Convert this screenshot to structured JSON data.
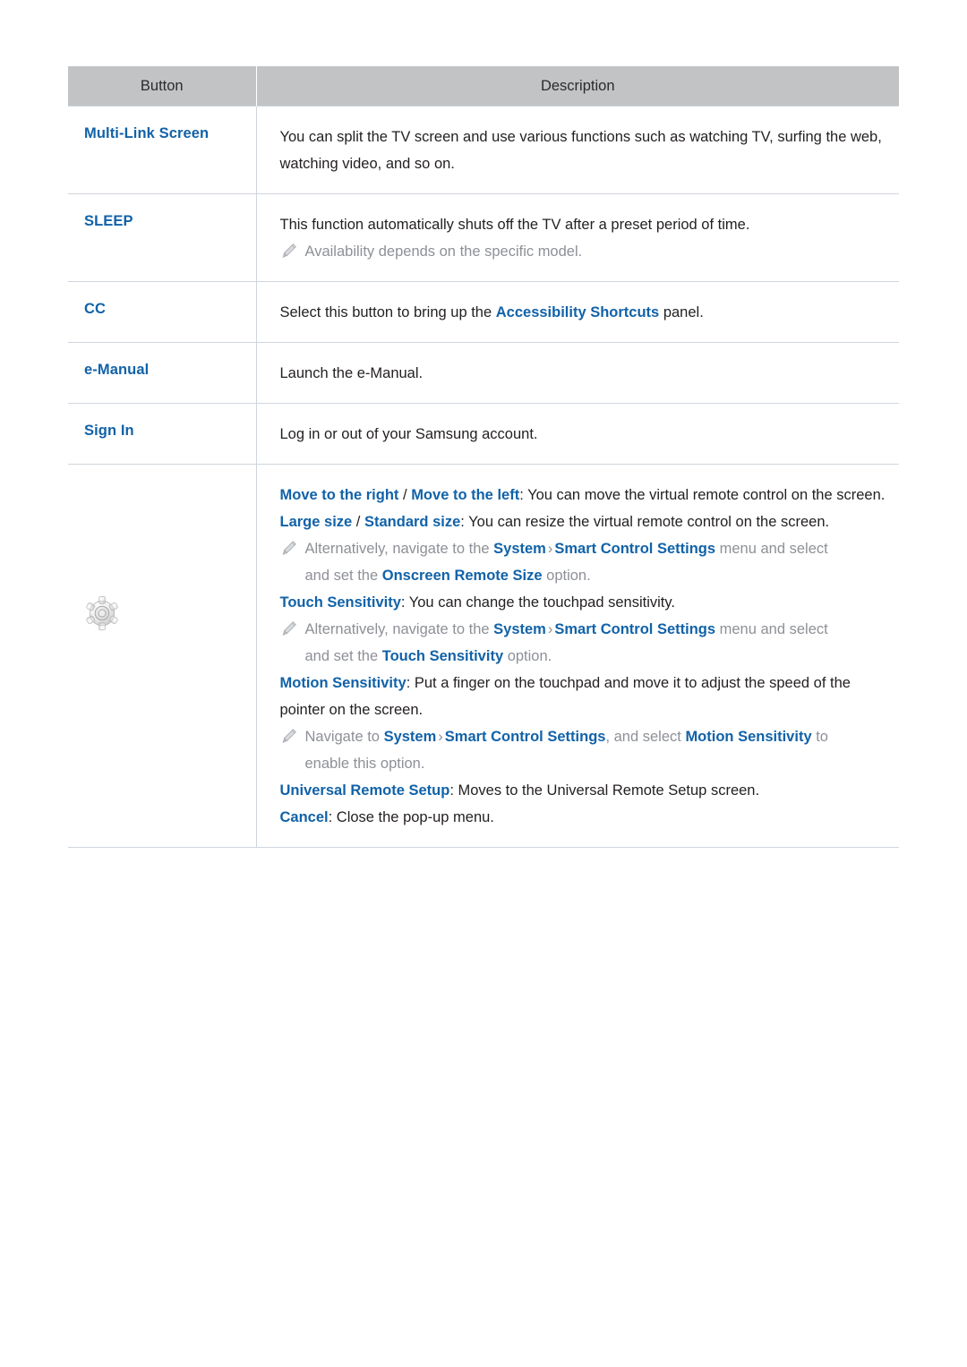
{
  "table": {
    "headers": [
      "Button",
      "Description"
    ],
    "rows": [
      {
        "button_label": "Multi-Link Screen",
        "button_icon": null,
        "lines": [
          "You can split the TV screen and use various functions such as watching TV, surfing the web, watching video, and so on."
        ]
      },
      {
        "button_label": "SLEEP",
        "button_icon": null,
        "lines": [
          "This function automatically shuts off the TV after a preset period of time.",
          "Availability depends on the specific model."
        ]
      },
      {
        "button_label": "CC",
        "button_icon": null,
        "lines": [
          "Select this button to bring up the Accessibility Shortcuts panel."
        ]
      },
      {
        "button_label": "e-Manual",
        "button_icon": null,
        "lines": [
          "Launch the e-Manual."
        ]
      },
      {
        "button_label": "Sign In",
        "button_icon": null,
        "lines": [
          "Log in or out of your Samsung account."
        ]
      },
      {
        "button_label": "",
        "button_icon": "gear-icon",
        "lines": [
          "Move to the right / Move to the left: You can move the virtual remote control on the screen.",
          "Large size / Standard size: You can resize the virtual remote control on the screen.",
          "Alternatively, navigate to the System > Smart Control Settings menu and select and set the Onscreen Remote Size option.",
          "Touch Sensitivity: You can change the touchpad sensitivity.",
          "Alternatively, navigate to the System > Smart Control Settings menu and select and set the Touch Sensitivity option.",
          "Motion Sensitivity: Put a finger on the touchpad and move it to adjust the speed of the pointer on the screen.",
          "Navigate to System > Smart Control Settings, and select Motion Sensitivity to enable this option.",
          "Universal Remote Setup: Moves to the Universal Remote Setup screen.",
          "Cancel: Close the pop-up menu."
        ]
      }
    ]
  },
  "text": {
    "row1": {
      "body": "You can split the TV screen and use various functions such as watching TV, surfing the web, watching video, and so on."
    },
    "row2": {
      "body": "This function automatically shuts off the TV after a preset period of time.",
      "note": "Availability depends on the specific model."
    },
    "row3": {
      "pre": "Select this button to bring up the ",
      "link": "Accessibility Shortcuts",
      "post": " panel."
    },
    "row4": {
      "body": "Launch the e-Manual."
    },
    "row5": {
      "body": "Log in or out of your Samsung account."
    },
    "row6": {
      "move_right": "Move to the right",
      "slash1": " / ",
      "move_left": "Move to the left",
      "move_rest": ": You can move the virtual remote control on the screen.",
      "large_size": "Large size",
      "slash2": " / ",
      "standard_size": "Standard size",
      "size_rest": ": You can resize the virtual remote control on the screen.",
      "note1_pre": "Alternatively, navigate to the ",
      "note1_sys": "System",
      "note1_chev": "›",
      "note1_scs": "Smart Control Settings",
      "note1_mid": " menu and select",
      "note1_line2_pre": "and set the ",
      "note1_line2_opt": "Onscreen Remote Size",
      "note1_line2_post": " option.",
      "touch_sens": "Touch Sensitivity",
      "touch_rest": ": You can change the touchpad sensitivity.",
      "note2_pre": "Alternatively, navigate to the ",
      "note2_sys": "System",
      "note2_chev": "›",
      "note2_scs": "Smart Control Settings",
      "note2_mid": " menu and select",
      "note2_line2_pre": "and set the ",
      "note2_line2_opt": "Touch Sensitivity",
      "note2_line2_post": " option.",
      "motion_sens": "Motion Sensitivity",
      "motion_rest": ": Put a finger on the touchpad and move it to adjust the speed of the pointer on the screen.",
      "note3_pre": "Navigate to ",
      "note3_sys": "System",
      "note3_chev": "›",
      "note3_scs": "Smart Control Settings",
      "note3_mid": ", and select ",
      "note3_opt": "Motion Sensitivity",
      "note3_post": " to",
      "note3_line2": "enable this option.",
      "urs": "Universal Remote Setup",
      "urs_rest": ": Moves to the Universal Remote Setup screen.",
      "cancel": "Cancel",
      "cancel_rest": ": Close the pop-up menu."
    }
  },
  "colors": {
    "link_blue": "#1162a8",
    "header_gray": "#c2c3c4",
    "note_gray": "#8d9096",
    "border_gray": "#cfd5dc",
    "body_text": "#231f20"
  }
}
